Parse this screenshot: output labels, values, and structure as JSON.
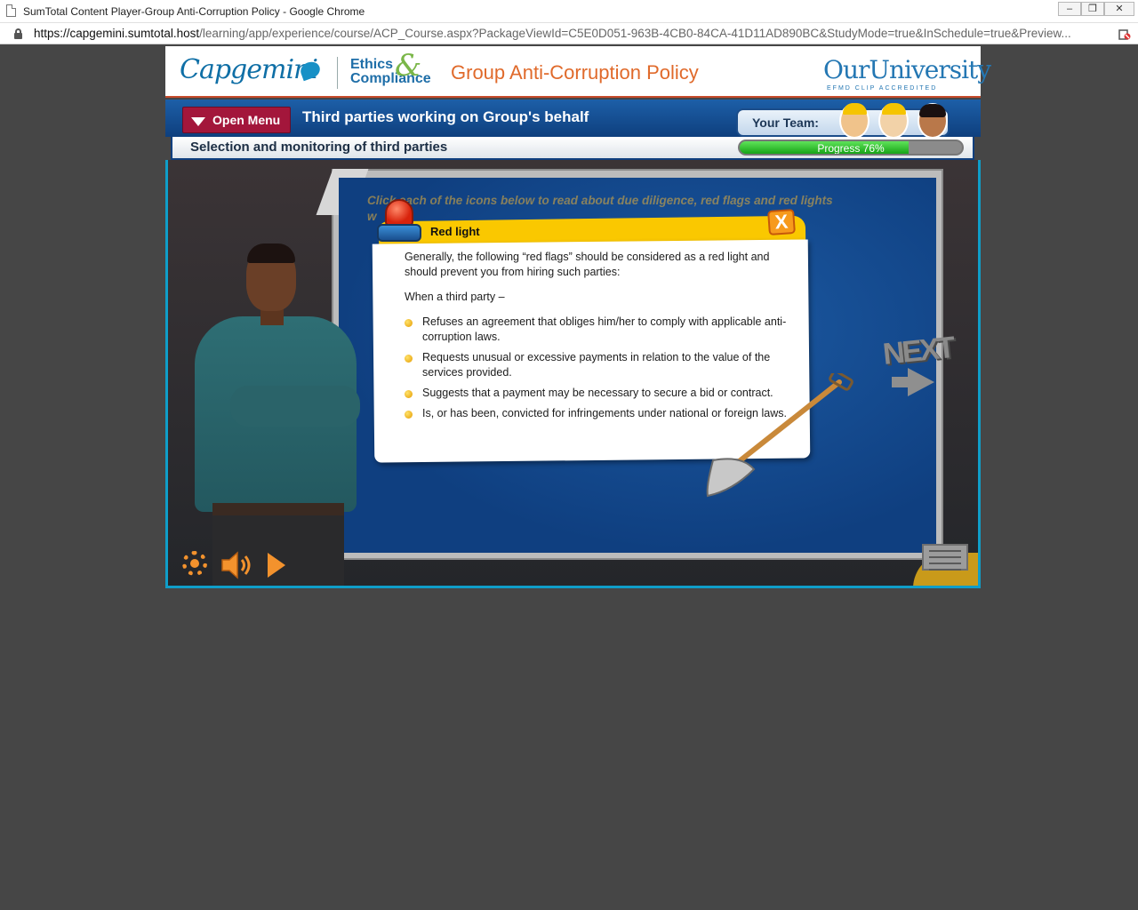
{
  "browser": {
    "window_title": "SumTotal Content Player-Group Anti-Corruption Policy - Google Chrome",
    "url_host": "https://capgemini.sumtotal.host",
    "url_path": "/learning/app/experience/course/ACP_Course.aspx?PackageViewId=C5E0D051-963B-4CB0-84CA-41D11AD890BC&StudyMode=true&InSchedule=true&Preview..."
  },
  "brand": {
    "capgemini": "Capgemini",
    "ethics_line1": "Ethics",
    "ethics_amp": "&",
    "ethics_line2": "Compliance",
    "course_title": "Group Anti-Corruption Policy",
    "our_university": "OurUniversity",
    "our_university_sub": "EFMD CLIP ACCREDITED"
  },
  "nav": {
    "open_menu": "Open Menu",
    "section_title": "Third parties working on Group's behalf",
    "team_label": "Your Team:"
  },
  "subheader": {
    "title": "Selection and monitoring of third parties",
    "progress_label": "Progress 76%",
    "progress_value": 0.76
  },
  "board": {
    "instruction_line1": "Click each of the icons below to read about due diligence, red flags and red lights",
    "instruction_line2": "w",
    "next_label": "NEXT"
  },
  "popup": {
    "title": "Red light",
    "close_label": "X",
    "intro": "Generally, the following “red flags” should be considered as a red light and should prevent you from hiring such parties:",
    "lead": "When a third party –",
    "bullets": [
      "Refuses an agreement that obliges him/her to comply with applicable anti-corruption laws.",
      "Requests unusual or excessive payments in relation to the value of the services provided.",
      "Suggests that a payment may be necessary to secure a bid or contract.",
      "Is, or has been, convicted for infringements under national or foreign laws."
    ]
  },
  "controls": {
    "settings_icon": "gear-icon",
    "audio_icon": "speaker-icon",
    "play_icon": "play-icon"
  },
  "colors": {
    "accent_orange": "#f3922d",
    "menu_red": "#a3163b",
    "nav_blue": "#1d5fa8",
    "popup_yellow": "#fac800",
    "frame_cyan": "#0f9ec9"
  }
}
